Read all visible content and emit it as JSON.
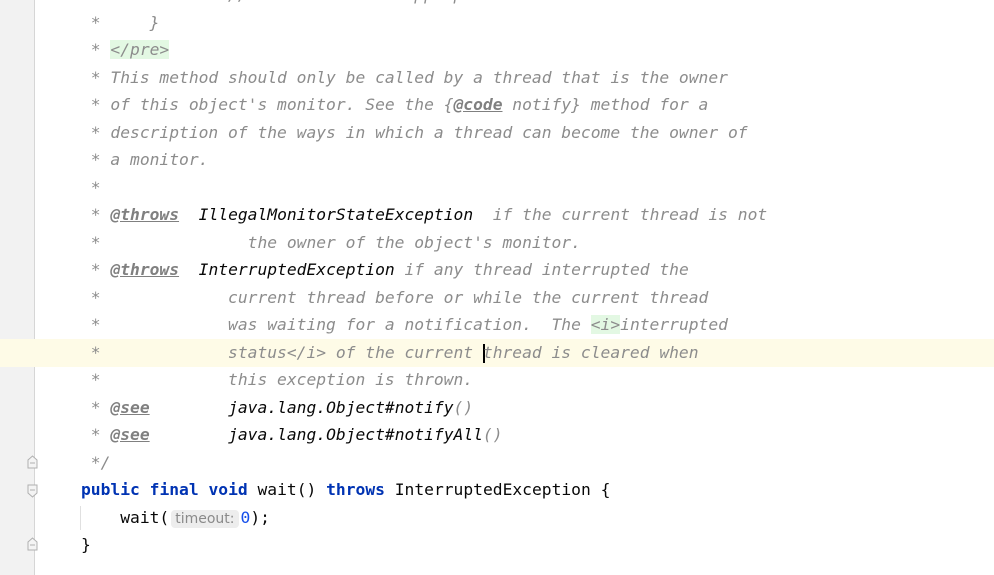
{
  "editor": {
    "language": "java",
    "current_line_index": 13,
    "lines": [
      {
        "segs": [
          {
            "k": "c",
            "t": "           ... // Perform action appropriate to condition"
          }
        ]
      },
      {
        "segs": [
          {
            "k": "c",
            "t": " *     }"
          }
        ]
      },
      {
        "segs": [
          {
            "k": "c",
            "t": " * "
          },
          {
            "k": "html",
            "t": "</pre>"
          }
        ]
      },
      {
        "segs": [
          {
            "k": "c",
            "t": " * This method should only be called by a thread that is the owner"
          }
        ]
      },
      {
        "segs": [
          {
            "k": "c",
            "t": " * of this object's monitor. See the {"
          },
          {
            "k": "tag",
            "t": "@code"
          },
          {
            "k": "c",
            "t": " notify} method for a"
          }
        ]
      },
      {
        "segs": [
          {
            "k": "c",
            "t": " * description of the ways in which a thread can become the owner of"
          }
        ]
      },
      {
        "segs": [
          {
            "k": "c",
            "t": " * a monitor."
          }
        ]
      },
      {
        "segs": [
          {
            "k": "c",
            "t": " *"
          }
        ]
      },
      {
        "segs": [
          {
            "k": "c",
            "t": " * "
          },
          {
            "k": "tag",
            "t": "@throws"
          },
          {
            "k": "c",
            "t": "  "
          },
          {
            "k": "ex",
            "t": "IllegalMonitorStateException"
          },
          {
            "k": "c",
            "t": "  if the current thread is not"
          }
        ]
      },
      {
        "segs": [
          {
            "k": "c",
            "t": " *               the owner of the object's monitor."
          }
        ]
      },
      {
        "segs": [
          {
            "k": "c",
            "t": " * "
          },
          {
            "k": "tag",
            "t": "@throws"
          },
          {
            "k": "c",
            "t": "  "
          },
          {
            "k": "ex",
            "t": "InterruptedException"
          },
          {
            "k": "c",
            "t": " if any thread interrupted the"
          }
        ]
      },
      {
        "segs": [
          {
            "k": "c",
            "t": " *             current thread before or while the current thread"
          }
        ]
      },
      {
        "segs": [
          {
            "k": "c",
            "t": " *             was waiting for a notification.  The "
          },
          {
            "k": "html",
            "t": "<i>"
          },
          {
            "k": "c",
            "t": "interrupted"
          }
        ]
      },
      {
        "segs": [
          {
            "k": "c",
            "t": " *             status</i> of the current "
          },
          {
            "k": "caret",
            "t": ""
          },
          {
            "k": "c",
            "t": "thread is cleared when"
          }
        ]
      },
      {
        "segs": [
          {
            "k": "c",
            "t": " *             this exception is thrown."
          }
        ]
      },
      {
        "segs": [
          {
            "k": "c",
            "t": " * "
          },
          {
            "k": "tag",
            "t": "@see"
          },
          {
            "k": "c",
            "t": "        "
          },
          {
            "k": "ex",
            "t": "java.lang.Object#notify"
          },
          {
            "k": "c",
            "t": "()"
          }
        ]
      },
      {
        "segs": [
          {
            "k": "c",
            "t": " * "
          },
          {
            "k": "tag",
            "t": "@see"
          },
          {
            "k": "c",
            "t": "        "
          },
          {
            "k": "ex",
            "t": "java.lang.Object#notifyAll"
          },
          {
            "k": "c",
            "t": "()"
          }
        ]
      },
      {
        "segs": [
          {
            "k": "c",
            "t": " */"
          }
        ]
      },
      {
        "segs": [
          {
            "k": "kw",
            "t": "public"
          },
          {
            "k": "p",
            "t": " "
          },
          {
            "k": "kw",
            "t": "final"
          },
          {
            "k": "p",
            "t": " "
          },
          {
            "k": "kw",
            "t": "void"
          },
          {
            "k": "p",
            "t": " wait() "
          },
          {
            "k": "kw",
            "t": "throws"
          },
          {
            "k": "p",
            "t": " InterruptedException {"
          }
        ]
      },
      {
        "segs": [
          {
            "k": "p",
            "t": "    wait("
          },
          {
            "k": "hint",
            "t": "timeout:"
          },
          {
            "k": "num",
            "t": "0"
          },
          {
            "k": "p",
            "t": ");"
          }
        ]
      },
      {
        "segs": [
          {
            "k": "p",
            "t": "}"
          }
        ]
      }
    ]
  },
  "gutter": {
    "fold_markers": [
      "fold-end-icon",
      "fold-start-icon",
      "fold-end-icon"
    ]
  }
}
